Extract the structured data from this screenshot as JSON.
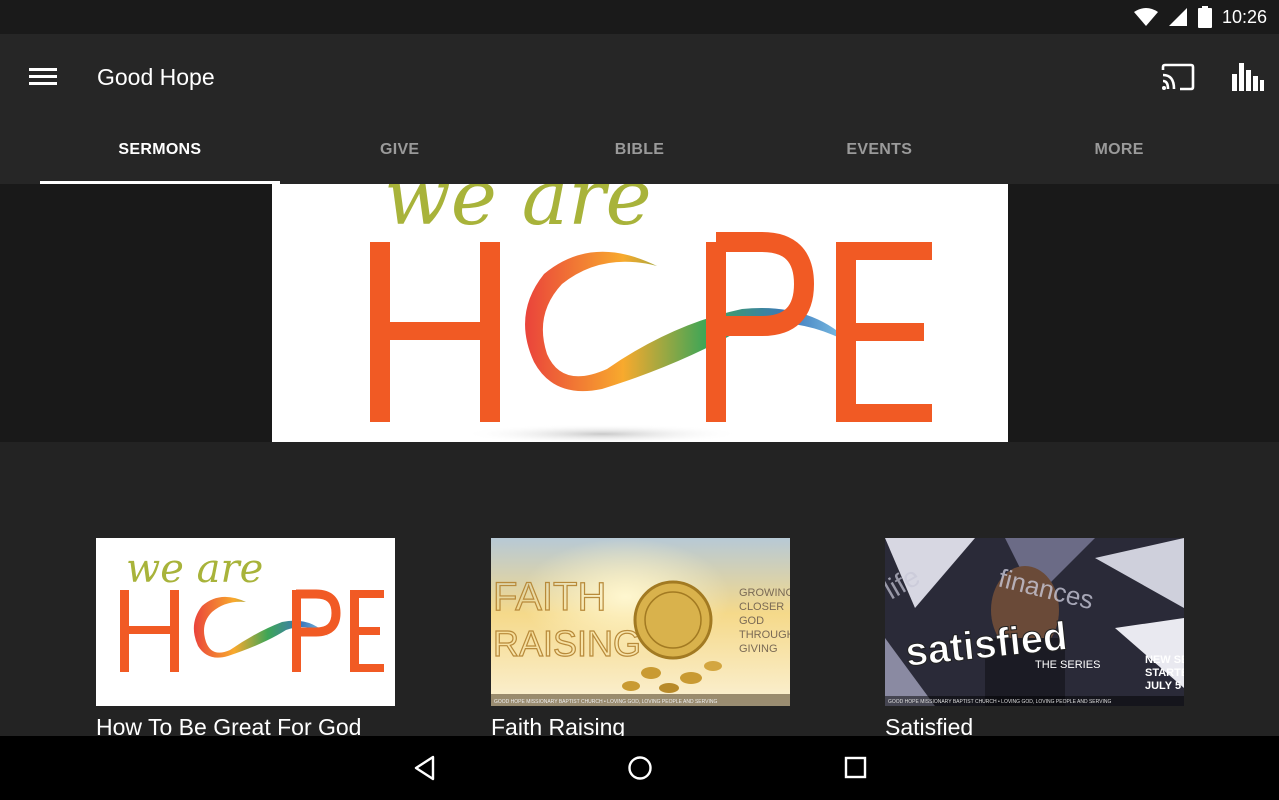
{
  "status_bar": {
    "time": "10:26",
    "icons": [
      "wifi-icon",
      "signal-icon",
      "battery-icon"
    ]
  },
  "app_bar": {
    "title": "Good Hope",
    "menu_icon": "menu-icon",
    "cast_icon": "cast-icon",
    "stats_icon": "bar-chart-icon"
  },
  "tabs": [
    {
      "label": "SERMONS",
      "active": true
    },
    {
      "label": "GIVE",
      "active": false
    },
    {
      "label": "BIBLE",
      "active": false
    },
    {
      "label": "EVENTS",
      "active": false
    },
    {
      "label": "MORE",
      "active": false
    }
  ],
  "hero": {
    "script_text": "we are",
    "word": "HOPE"
  },
  "cards": [
    {
      "title": "How To Be Great For God",
      "art": {
        "script": "we are",
        "word": "HOPE"
      }
    },
    {
      "title": "Faith Raising",
      "art": {
        "line1": "FAITH",
        "line2": "RAISING",
        "side": [
          "GROWING",
          "CLOSER",
          "GOD",
          "THROUGH",
          "GIVING"
        ],
        "footer": "GOOD HOPE MISSIONARY BAPTIST CHURCH • LOVING GOD, LOVING PEOPLE AND SERVING"
      }
    },
    {
      "title": "Satisfied",
      "art": {
        "word": "satisfied",
        "sub": "THE SERIES",
        "top1": "life",
        "top2": "finances",
        "side": [
          "NEW SE",
          "STARTE",
          "JULY 5"
        ],
        "footer": "GOOD HOPE MISSIONARY BAPTIST CHURCH • LOVING GOD, LOVING PEOPLE AND SERVING"
      }
    }
  ],
  "colors": {
    "hope_orange": "#f15a24",
    "script_green": "#a8b33a",
    "app_bar": "#262626",
    "background": "#232323"
  },
  "nav_bar": {
    "icons": [
      "back-icon",
      "home-icon",
      "recents-icon"
    ]
  }
}
